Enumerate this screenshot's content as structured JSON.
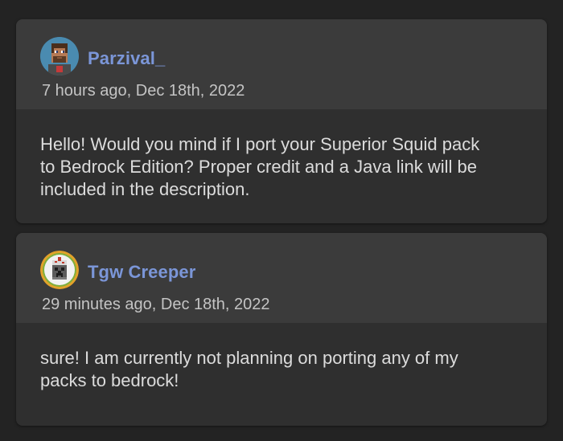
{
  "comments": [
    {
      "username": "Parzival_",
      "timestamp": "7 hours ago, Dec 18th, 2022",
      "message_lines": [
        "Hello! Would you mind if I port your Superior Squid pack",
        "to Bedrock Edition? Proper credit and a Java link will be",
        "included in the description."
      ],
      "avatar_icon": "pixel-skin-avatar-icon"
    },
    {
      "username": "Tgw Creeper",
      "timestamp": "29 minutes ago, Dec 18th, 2022",
      "message_lines": [
        "sure! I am currently not planning on porting any of my",
        "packs to bedrock!"
      ],
      "avatar_icon": "creeper-cake-avatar-icon"
    }
  ],
  "colors": {
    "page_background": "#232323",
    "card_header": "#3b3b3b",
    "card_body": "#2f2f2f",
    "username": "#7b96d8",
    "timestamp": "#c4c4c4",
    "message": "#dcdcdc"
  }
}
